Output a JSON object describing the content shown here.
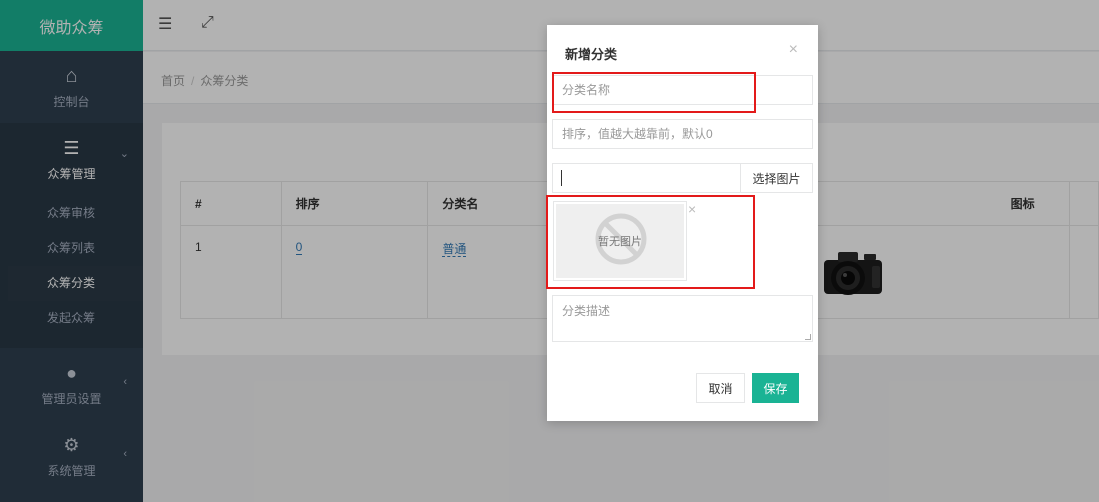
{
  "app": {
    "brand": "微助众筹"
  },
  "sidebar": {
    "home": {
      "label": "控制台",
      "icon": "home-icon"
    },
    "group": {
      "label": "众筹管理",
      "icon": "list-icon",
      "items": [
        {
          "label": "众筹审核"
        },
        {
          "label": "众筹列表"
        },
        {
          "label": "众筹分类"
        },
        {
          "label": "发起众筹"
        }
      ]
    },
    "admin": {
      "label": "管理员设置",
      "icon": "user-icon"
    },
    "system": {
      "label": "系统管理",
      "icon": "gear-icon"
    }
  },
  "topbar": {
    "menu_icon": "menu-icon",
    "expand_icon": "expand-icon"
  },
  "breadcrumb": {
    "home": "首页",
    "separator": "/",
    "current": "众筹分类"
  },
  "table": {
    "headers": [
      "#",
      "排序",
      "分类名",
      "图标"
    ],
    "rows": [
      {
        "id": "1",
        "sort": "0",
        "name": "普通"
      }
    ]
  },
  "modal": {
    "title": "新增分类",
    "name_placeholder": "分类名称",
    "sort_placeholder": "排序，值越大越靠前，默认0",
    "choose_image": "选择图片",
    "no_image": "暂无图片",
    "desc_placeholder": "分类描述",
    "cancel": "取消",
    "save": "保存"
  },
  "colors": {
    "brand": "#1ab394",
    "sidebar": "#2f4050",
    "highlight": "#e31a1a"
  }
}
